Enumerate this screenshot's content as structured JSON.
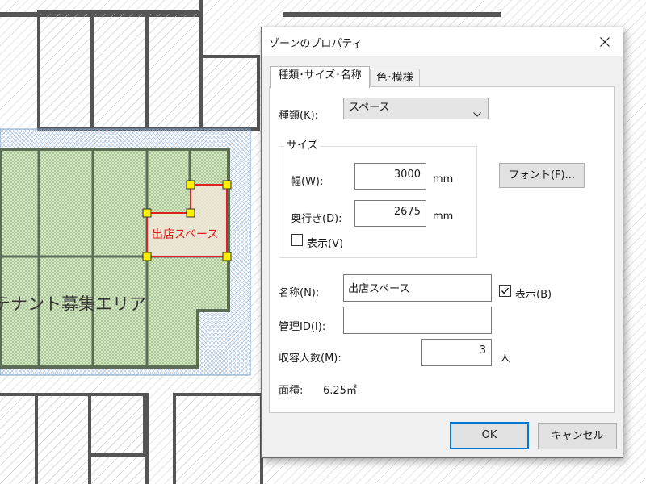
{
  "canvas": {
    "zone_area_label": "テナント募集エリア",
    "selected_zone_label": "出店スペース",
    "colors": {
      "zone_fill": "#dcebd2",
      "zone_hatch": "#8fb46f",
      "zone_grid": "#5b6e55",
      "zone_outline": "#7aa0c8",
      "selected_outline": "#e02020",
      "selected_label": "#e02020",
      "handle": "#ffee00"
    }
  },
  "dialog": {
    "title": "ゾーンのプロパティ",
    "close_icon": "close-icon",
    "tabs": [
      {
        "label": "種類･サイズ･名称",
        "active": true
      },
      {
        "label": "色･模様",
        "active": false
      }
    ],
    "type": {
      "label": "種類(K):",
      "value": "スペース"
    },
    "size_group": {
      "legend": "サイズ",
      "width": {
        "label": "幅(W):",
        "value": "3000",
        "unit": "mm"
      },
      "depth": {
        "label": "奥行き(D):",
        "value": "2675",
        "unit": "mm"
      },
      "show": {
        "label": "表示(V)",
        "checked": false
      }
    },
    "font_button": "フォント(F)...",
    "name": {
      "label": "名称(N):",
      "value": "出店スペース"
    },
    "name_show": {
      "label": "表示(B)",
      "checked": true
    },
    "management_id": {
      "label": "管理ID(I):",
      "value": ""
    },
    "capacity": {
      "label": "収容人数(M):",
      "value": "3",
      "unit": "人"
    },
    "area": {
      "label": "面積:",
      "value": "6.25㎡"
    },
    "ok_button": "OK",
    "cancel_button": "キャンセル"
  }
}
